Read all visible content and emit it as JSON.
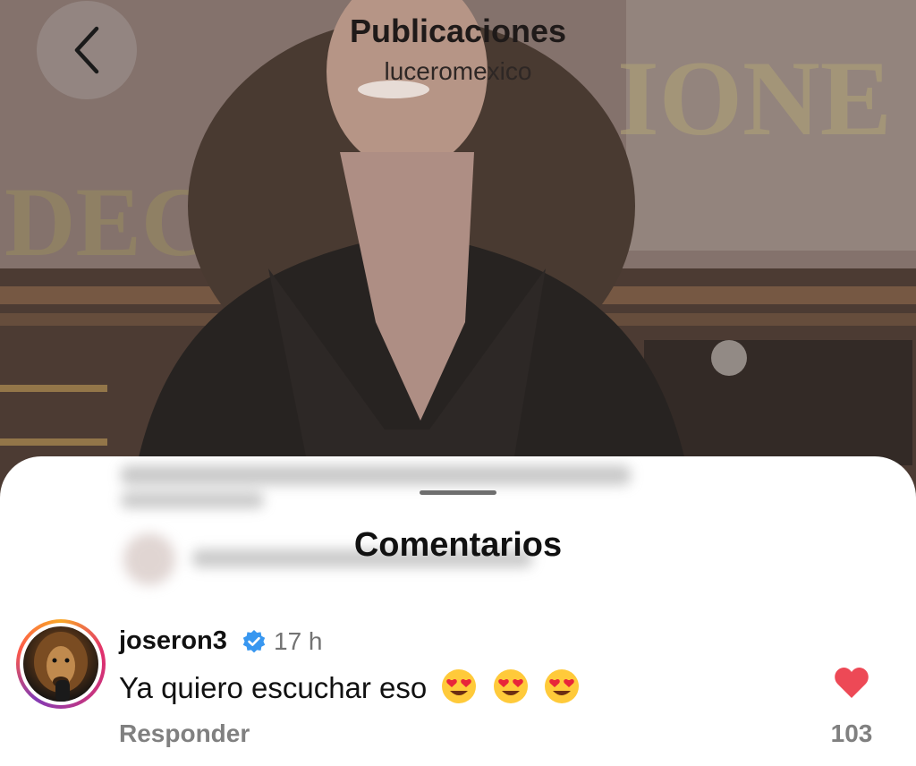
{
  "header": {
    "title": "Publicaciones",
    "username": "luceromexico"
  },
  "sheet": {
    "title": "Comentarios"
  },
  "comment": {
    "username": "joseron3",
    "verified": true,
    "time": "17 h",
    "text": "Ya quiero escuchar eso",
    "emojis": [
      "heart-eyes-emoji",
      "heart-eyes-emoji",
      "heart-eyes-emoji"
    ],
    "reply_label": "Responder",
    "like_count": "103",
    "liked": true
  },
  "colors": {
    "like_red": "#ed4956",
    "verified_blue": "#3897f0",
    "secondary_text": "#808080"
  }
}
